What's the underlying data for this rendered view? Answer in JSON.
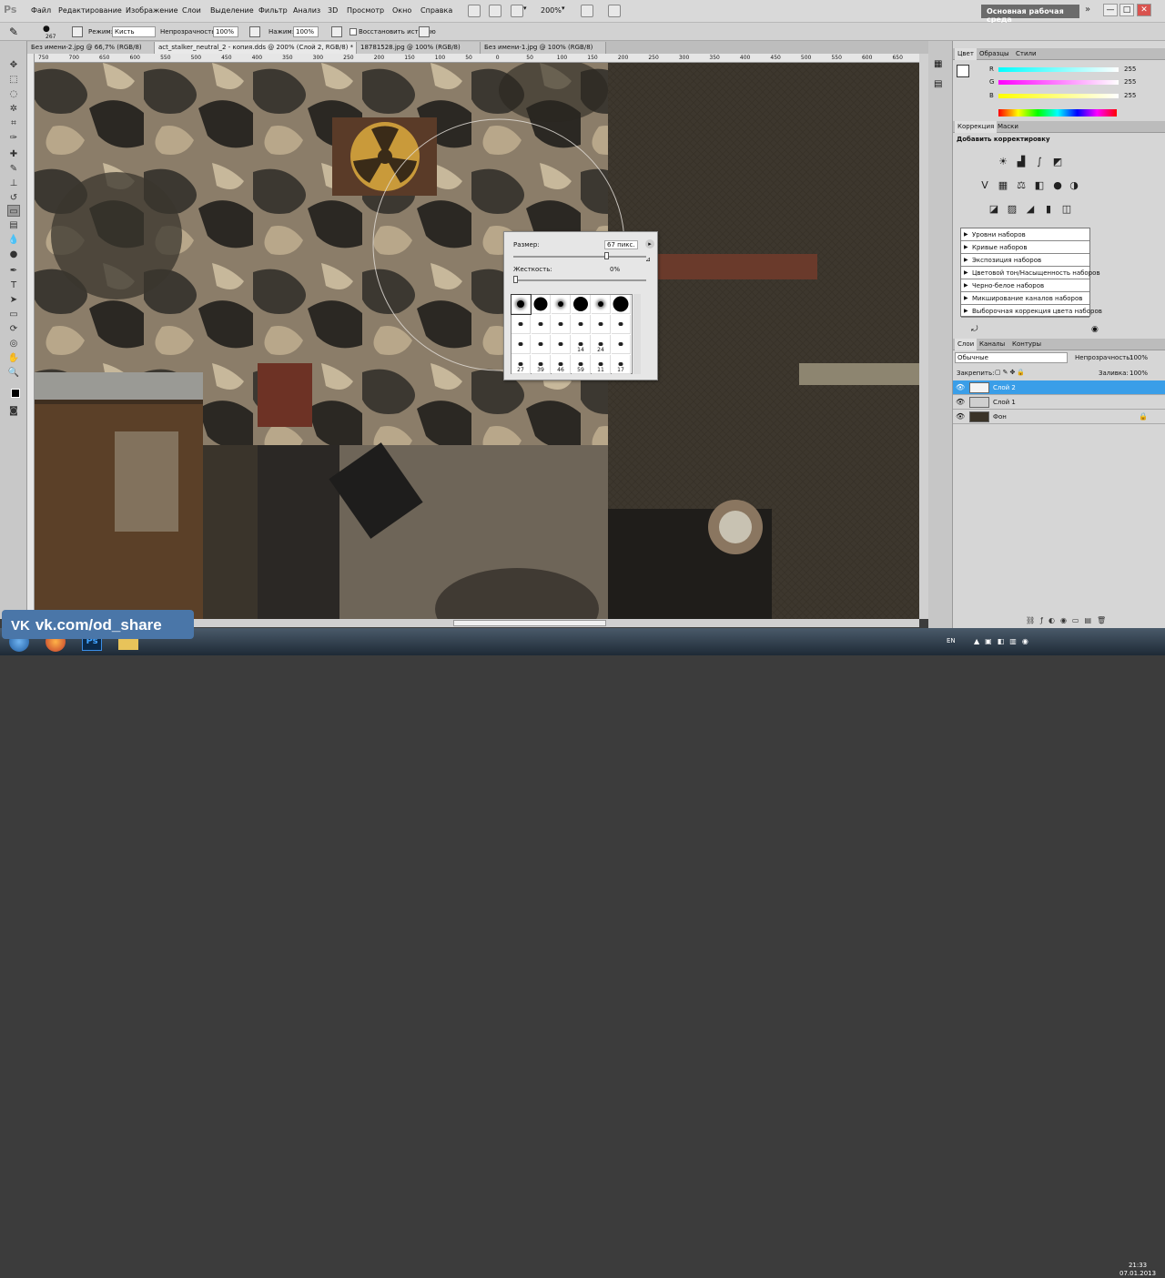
{
  "app": {
    "logo": "Ps"
  },
  "menu": [
    "Файл",
    "Редактирование",
    "Изображение",
    "Слои",
    "Выделение",
    "Фильтр",
    "Анализ",
    "3D",
    "Просмотр",
    "Окно",
    "Справка"
  ],
  "toolbar": {
    "zoom": "200%",
    "workspace": "Основная рабочая среда",
    "minimize": "—",
    "maximize": "□",
    "close": "✕"
  },
  "options": {
    "brush_size": "267",
    "mode_label": "Режим:",
    "mode_value": "Кисть",
    "opacity_label": "Непрозрачность:",
    "opacity_value": "100%",
    "pressure_label": "Нажим:",
    "pressure_value": "100%",
    "history_label": "Восстановить историю"
  },
  "tabs": [
    "Без имени-2.jpg @ 66,7% (RGB/8)",
    "act_stalker_neutral_2 - копия.dds @ 200% (Слой 2, RGB/8) *",
    "18781528.jpg @ 100% (RGB/8)",
    "Без имени-1.jpg @ 100% (RGB/8)"
  ],
  "ruler_ticks": [
    "750",
    "700",
    "650",
    "600",
    "550",
    "500",
    "450",
    "400",
    "350",
    "300",
    "250",
    "200",
    "150",
    "100",
    "50",
    "0",
    "50",
    "100",
    "150",
    "200",
    "250",
    "300",
    "350",
    "400",
    "450",
    "500",
    "550",
    "600",
    "650"
  ],
  "color_panel": {
    "tabs": [
      "Цвет",
      "Образцы",
      "Стили"
    ],
    "channels": [
      {
        "label": "R",
        "value": "255"
      },
      {
        "label": "G",
        "value": "255"
      },
      {
        "label": "B",
        "value": "255"
      }
    ]
  },
  "adjust_panel": {
    "tabs": [
      "Коррекция",
      "Маски"
    ],
    "title": "Добавить корректировку",
    "presets": [
      "Уровни наборов",
      "Кривые наборов",
      "Экспозиция наборов",
      "Цветовой тон/Насыщенность наборов",
      "Черно-белое наборов",
      "Микширование каналов наборов",
      "Выборочная коррекция цвета наборов"
    ]
  },
  "layers_panel": {
    "tabs": [
      "Слои",
      "Каналы",
      "Контуры"
    ],
    "blend": "Обычные",
    "opacity_label": "Непрозрачность:",
    "opacity_value": "100%",
    "lock_label": "Закрепить:",
    "fill_label": "Заливка:",
    "fill_value": "100%",
    "layers": [
      {
        "name": "Слой 2",
        "selected": true
      },
      {
        "name": "Слой 1",
        "selected": false
      },
      {
        "name": "Фон",
        "selected": false,
        "locked": true
      }
    ]
  },
  "brush_popup": {
    "size_label": "Размер:",
    "size_value": "67 пикс.",
    "hardness_label": "Жесткость:",
    "hardness_value": "0%",
    "brushes": [
      {
        "d": 8,
        "n": ""
      },
      {
        "d": 15,
        "n": ""
      },
      {
        "d": 6,
        "n": ""
      },
      {
        "d": 16,
        "n": ""
      },
      {
        "d": 6,
        "n": ""
      },
      {
        "d": 17,
        "n": ""
      },
      {
        "d": 5,
        "n": ""
      },
      {
        "d": 5,
        "n": ""
      },
      {
        "d": 5,
        "n": ""
      },
      {
        "d": 5,
        "n": ""
      },
      {
        "d": 5,
        "n": ""
      },
      {
        "d": 5,
        "n": ""
      },
      {
        "d": 5,
        "n": ""
      },
      {
        "d": 5,
        "n": ""
      },
      {
        "d": 5,
        "n": ""
      },
      {
        "d": 5,
        "n": "14"
      },
      {
        "d": 5,
        "n": "24"
      },
      {
        "d": 5,
        "n": ""
      },
      {
        "d": 5,
        "n": "27"
      },
      {
        "d": 5,
        "n": "39"
      },
      {
        "d": 5,
        "n": "46"
      },
      {
        "d": 5,
        "n": "59"
      },
      {
        "d": 5,
        "n": "11"
      },
      {
        "d": 5,
        "n": "17"
      }
    ]
  },
  "watermark": "vk.com/od_share",
  "taskbar": {
    "lang": "EN",
    "time": "21:33",
    "date": "07.01.2013"
  }
}
